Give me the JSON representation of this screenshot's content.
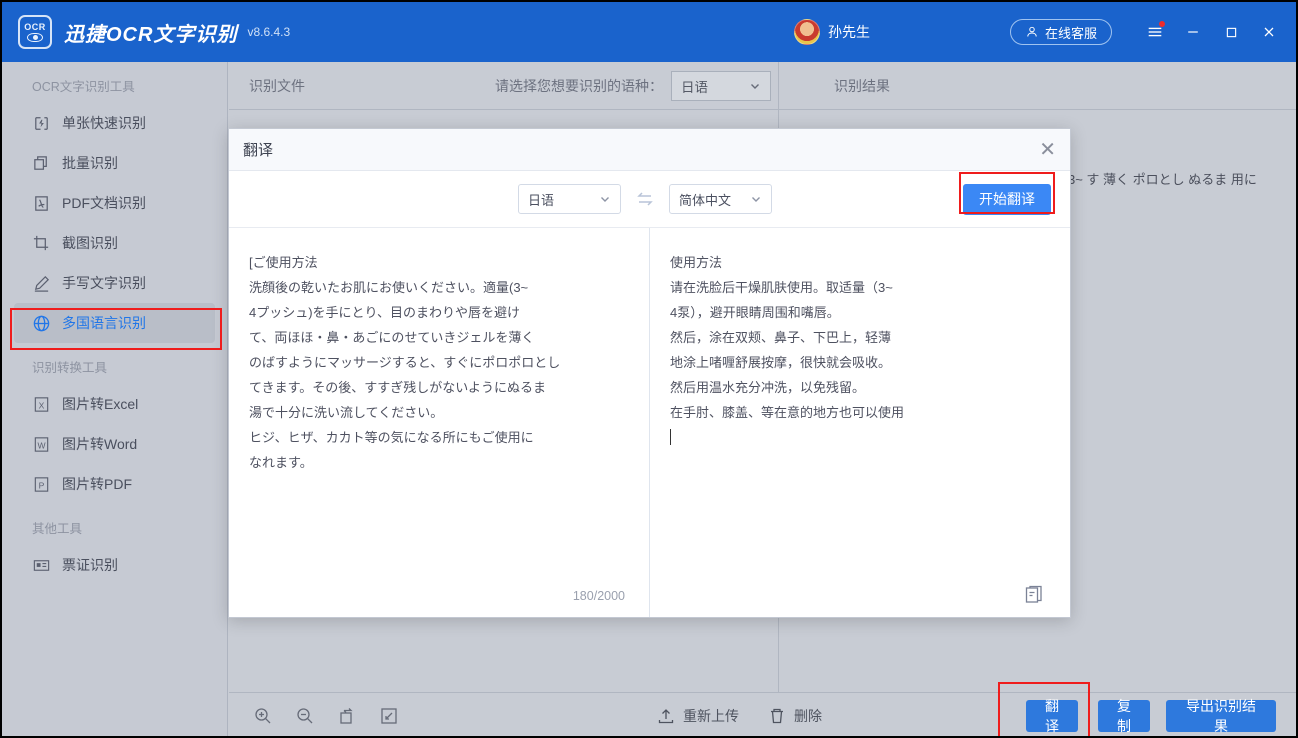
{
  "titlebar": {
    "logo_text": "OCR",
    "app_title": "迅捷OCR文字识别",
    "version": "v8.6.4.3",
    "user_name": "孙先生",
    "service_button": "在线客服",
    "menu_icon": "hamburger-menu-icon",
    "minimize_icon": "minimize-icon",
    "maximize_icon": "maximize-icon",
    "close_icon": "close-icon",
    "background_color": "#1a63cc"
  },
  "sidebar": {
    "groups": [
      {
        "label": "OCR文字识别工具",
        "items": [
          {
            "label": "单张快速识别",
            "icon": "single-quick-recognize-icon",
            "active": false
          },
          {
            "label": "批量识别",
            "icon": "batch-recognize-icon",
            "active": false
          },
          {
            "label": "PDF文档识别",
            "icon": "pdf-document-icon",
            "active": false
          },
          {
            "label": "截图识别",
            "icon": "screenshot-crop-icon",
            "active": false
          },
          {
            "label": "手写文字识别",
            "icon": "handwriting-pen-icon",
            "active": false
          },
          {
            "label": "多国语言识别",
            "icon": "globe-icon",
            "active": true
          }
        ]
      },
      {
        "label": "识别转换工具",
        "items": [
          {
            "label": "图片转Excel",
            "icon": "excel-icon",
            "active": false
          },
          {
            "label": "图片转Word",
            "icon": "word-icon",
            "active": false
          },
          {
            "label": "图片转PDF",
            "icon": "pdf-icon",
            "active": false
          }
        ]
      },
      {
        "label": "其他工具",
        "items": [
          {
            "label": "票证识别",
            "icon": "invoice-card-icon",
            "active": false
          }
        ]
      }
    ]
  },
  "toolbar": {
    "file_panel_label": "识别文件",
    "language_prompt": "请选择您想要识别的语种：",
    "language_value": "日语",
    "result_panel_label": "识别结果",
    "dropdown_icon": "chevron-down-icon"
  },
  "background_result_text": "3~\nす\n薄く\nポロとし\nぬるま\n\n用に",
  "bottombar": {
    "icons": [
      {
        "name": "zoom-in-icon"
      },
      {
        "name": "zoom-out-icon"
      },
      {
        "name": "rotate-icon"
      },
      {
        "name": "fit-screen-icon"
      }
    ],
    "reupload_label": "重新上传",
    "reupload_icon": "upload-icon",
    "delete_label": "删除",
    "delete_icon": "trash-icon",
    "translate_button": "翻译",
    "copy_button": "复制",
    "export_button": "导出识别结果",
    "button_color": "#2e79dd"
  },
  "dialog": {
    "title": "翻译",
    "close_icon": "close-icon",
    "source_language": "日语",
    "target_language": "简体中文",
    "swap_icon": "swap-arrows-icon",
    "start_button": "开始翻译",
    "start_button_color": "#3b88f5",
    "source_text": "[ご使用方法\n洗顔後の乾いたお肌にお使いください。適量(3~\n4プッシュ)を手にとり、目のまわりや唇を避け\nて、両ほほ・鼻・あごにのせていきジェルを薄く\nのばすようにマッサージすると、すぐにポロポロとし\nてきます。その後、すすぎ残しがないようにぬるま\n湯で十分に洗い流してください。\nヒジ、ヒザ、カカト等の気になる所にもご使用に\nなれます。",
    "char_counter": "180/2000",
    "target_text": "使用方法\n请在洗脸后干燥肌肤使用。取适量（3~\n4泵），避开眼睛周围和嘴唇。\n然后，涂在双颊、鼻子、下巴上，轻薄\n地涂上啫喱舒展按摩，很快就会吸收。\n然后用温水充分冲洗，以免残留。\n在手肘、膝盖、等在意的地方也可以使用",
    "copy_icon": "copy-icon"
  },
  "annotations": {
    "highlight_color": "#ef1c1c"
  }
}
